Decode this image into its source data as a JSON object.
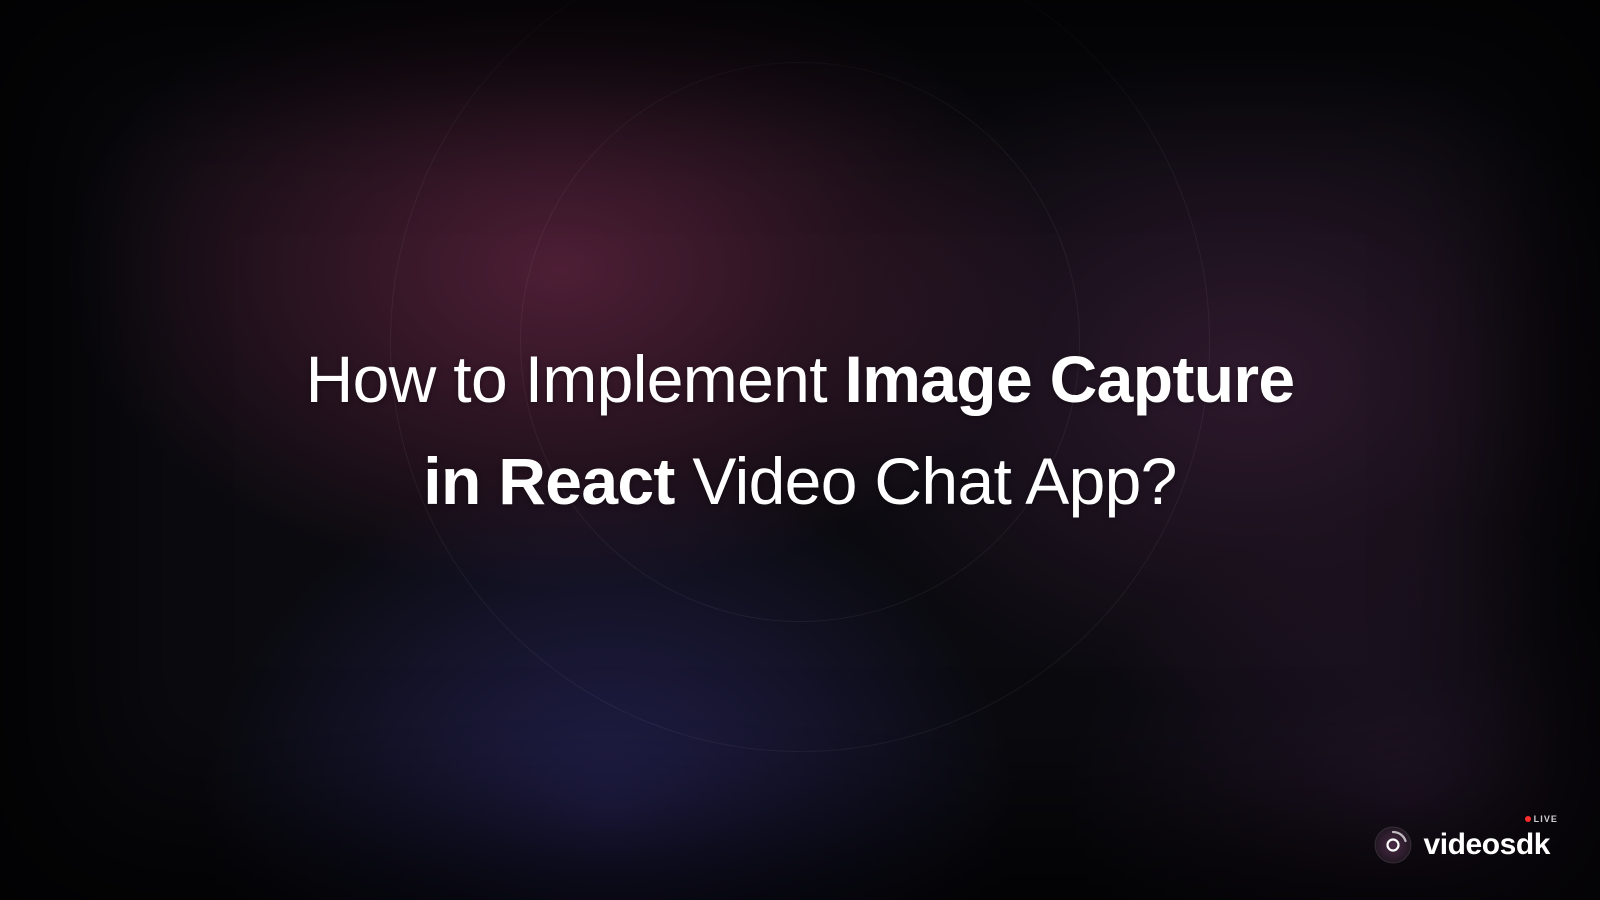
{
  "title": {
    "segments": [
      {
        "text": "How to Implement ",
        "weight": "light"
      },
      {
        "text": "Image Capture",
        "weight": "bold"
      },
      {
        "text": " ",
        "weight": "light"
      },
      {
        "text": "in React",
        "weight": "bold"
      },
      {
        "text": " Video Chat App?",
        "weight": "light"
      }
    ],
    "line1_light": "How to Implement ",
    "line1_bold": "Image Capture",
    "line2_bold": "in React",
    "line2_light": " Video Chat App?"
  },
  "brand": {
    "name": "videosdk",
    "badge": "LIVE",
    "icon_name": "videosdk-logo-icon"
  }
}
